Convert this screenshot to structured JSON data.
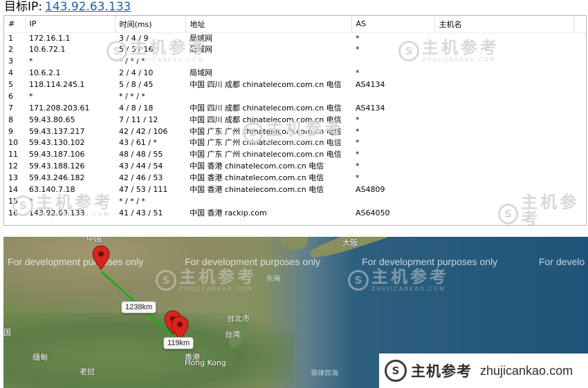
{
  "header": {
    "label": "目标IP:",
    "ip": "143.92.63.133"
  },
  "table": {
    "columns": [
      "#",
      "IP",
      "时间(ms)",
      "地址",
      "AS",
      "主机名"
    ],
    "rows": [
      [
        "1",
        "172.16.1.1",
        "3 / 4 / 9",
        "局域网",
        "*",
        ""
      ],
      [
        "2",
        "10.6.72.1",
        "5 / 5 / 16",
        "局域网",
        "*",
        ""
      ],
      [
        "3",
        "*",
        "* / * / *",
        "",
        "",
        ""
      ],
      [
        "4",
        "10.6.2.1",
        "2 / 4 / 10",
        "局域网",
        "*",
        ""
      ],
      [
        "5",
        "118.114.245.1",
        "5 / 8 / 45",
        "中国 四川 成都 chinatelecom.com.cn 电信",
        "AS4134",
        ""
      ],
      [
        "6",
        "*",
        "* / * / *",
        "",
        "",
        ""
      ],
      [
        "7",
        "171.208.203.61",
        "4 / 8 / 18",
        "中国 四川 成都 chinatelecom.com.cn 电信",
        "AS4134",
        ""
      ],
      [
        "8",
        "59.43.80.65",
        "7 / 11 / 12",
        "中国 四川 成都 chinatelecom.com.cn 电信",
        "*",
        ""
      ],
      [
        "9",
        "59.43.137.217",
        "42 / 42 / 106",
        "中国 广东 广州 chinatelecom.com.cn 电信",
        "*",
        ""
      ],
      [
        "10",
        "59.43.130.102",
        "43 / 61 / *",
        "中国 广东 广州 chinatelecom.com.cn 电信",
        "*",
        ""
      ],
      [
        "11",
        "59.43.187.106",
        "48 / 48 / 55",
        "中国 广东 广州 chinatelecom.com.cn 电信",
        "*",
        ""
      ],
      [
        "12",
        "59.43.188.126",
        "43 / 44 / 54",
        "中国 香港 chinatelecom.com.cn 电信",
        "*",
        ""
      ],
      [
        "13",
        "59.43.246.182",
        "42 / 46 / 53",
        "中国 香港 chinatelecom.com.cn 电信",
        "*",
        ""
      ],
      [
        "14",
        "63.140.7.18",
        "47 / 53 / 111",
        "中国 香港 chinatelecom.com.cn 电信",
        "AS4809",
        ""
      ],
      [
        "15",
        "*",
        "* / * / *",
        "",
        "",
        ""
      ],
      [
        "16",
        "143.92.63.133",
        "41 / 43 / 51",
        "中国 香港 rackip.com",
        "AS64050",
        ""
      ]
    ]
  },
  "watermark": {
    "cn": "主机参考",
    "en": "ZHUJICANKAO.COM",
    "glyph": "S"
  },
  "map": {
    "dev_notice": "For development purposes only",
    "dev_notice_cut": "For develo",
    "labels": {
      "china": "中国",
      "osaka": "大阪",
      "east_sea": "东海",
      "taipei": "台北市",
      "taiwan": "台湾",
      "myanmar_edge": "国",
      "myanmar": "缅甸",
      "laos": "老挝",
      "hongkong_cn": "香港",
      "hongkong_en": "Hong Kong",
      "philippine_sea": "菲律宾海"
    },
    "distances": [
      "1238km",
      "119km"
    ],
    "pin_color": "#d9251d",
    "route_color": "#1faa1f"
  },
  "footer_logo": {
    "cn": "主机参考",
    "url": "zhujicankao.com",
    "glyph": "S"
  }
}
